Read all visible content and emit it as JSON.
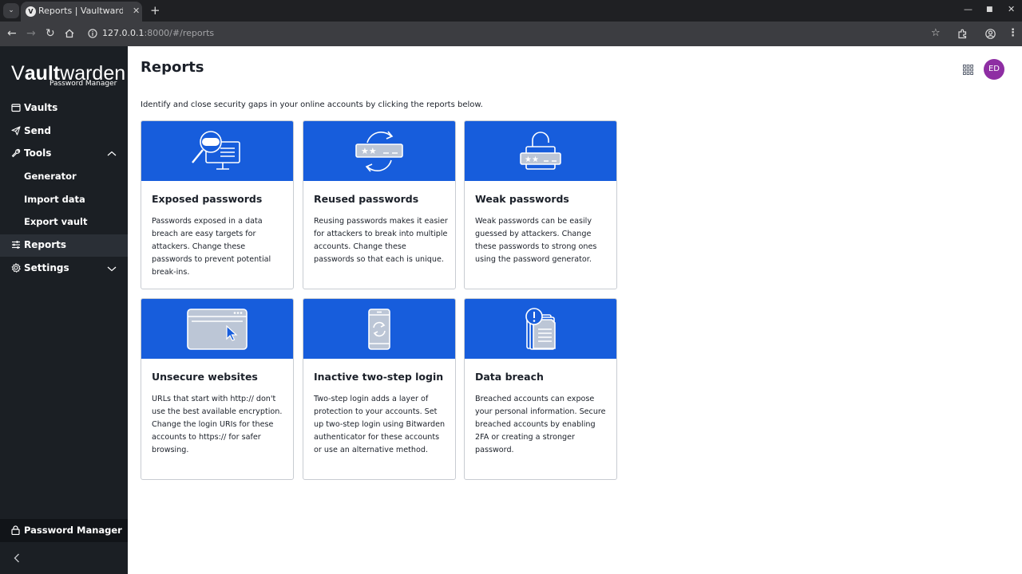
{
  "browser": {
    "tab_title": "Reports | Vaultwarden W",
    "tab_favicon": "V",
    "new_tab_glyph": "+",
    "url_host": "127.0.0.1",
    "url_rest": ":8000/#/reports"
  },
  "sidebar": {
    "logo_main_light": "V",
    "logo_main_bold": "ault",
    "logo_main_rest": "warden",
    "logo_sub": "Password Manager",
    "items": [
      {
        "label": "Vaults",
        "icon": "vault-icon"
      },
      {
        "label": "Send",
        "icon": "send-icon"
      },
      {
        "label": "Tools",
        "icon": "wrench-icon"
      },
      {
        "label": "Generator"
      },
      {
        "label": "Import data"
      },
      {
        "label": "Export vault"
      },
      {
        "label": "Reports",
        "icon": "sliders-icon"
      },
      {
        "label": "Settings",
        "icon": "gear-icon"
      }
    ],
    "footer_label": "Password Manager"
  },
  "header": {
    "title": "Reports",
    "avatar_initials": "ED",
    "avatar_color": "#8e2ea3"
  },
  "intro": "Identify and close security gaps in your online accounts by clicking the reports below.",
  "accent_color": "#175ddc",
  "reports": [
    {
      "title": "Exposed passwords",
      "description": "Passwords exposed in a data breach are easy targets for attackers. Change these passwords to prevent potential break-ins.",
      "icon": "magnifier-monitor-icon"
    },
    {
      "title": "Reused passwords",
      "description": "Reusing passwords makes it easier for attackers to break into multiple accounts. Change these passwords so that each is unique.",
      "icon": "recycle-password-icon"
    },
    {
      "title": "Weak passwords",
      "description": "Weak passwords can be easily guessed by attackers. Change these passwords to strong ones using the password generator.",
      "icon": "open-lock-icon"
    },
    {
      "title": "Unsecure websites",
      "description": "URLs that start with http:// don't use the best available encryption. Change the login URIs for these accounts to https:// for safer browsing.",
      "icon": "browser-window-icon"
    },
    {
      "title": "Inactive two-step login",
      "description": "Two-step login adds a layer of protection to your accounts. Set up two-step login using Bitwarden authenticator for these accounts or use an alternative method.",
      "icon": "phone-sync-icon"
    },
    {
      "title": "Data breach",
      "description": "Breached accounts can expose your personal information. Secure breached accounts by enabling 2FA or creating a stronger password.",
      "icon": "alert-document-icon"
    }
  ]
}
